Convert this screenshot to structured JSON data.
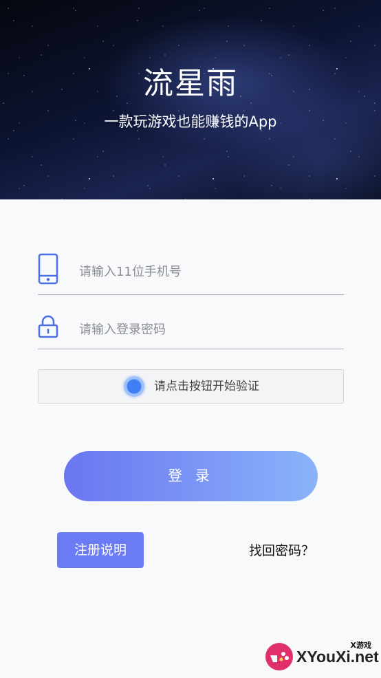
{
  "header": {
    "title": "流星雨",
    "subtitle": "一款玩游戏也能赚钱的App"
  },
  "login_form": {
    "phone": {
      "placeholder": "请输入11位手机号",
      "value": "",
      "icon": "phone-icon"
    },
    "password": {
      "placeholder": "请输入登录密码",
      "value": "",
      "icon": "lock-icon"
    },
    "verify": {
      "label": "请点击按钮开始验证"
    },
    "login_button": "登 录"
  },
  "footer_actions": {
    "register_label": "注册说明",
    "forgot_label": "找回密码？"
  },
  "watermark": {
    "caption": "X游戏",
    "brand": "XYouXi.net"
  },
  "colors": {
    "accent": "#6b7bf4",
    "icon_blue": "#4a6fe3",
    "verify_dot": "#3f7ef5"
  }
}
